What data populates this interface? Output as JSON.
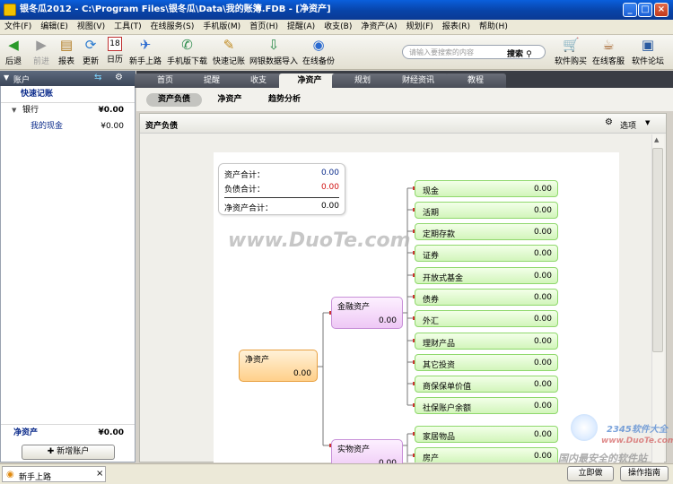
{
  "window": {
    "title": "银冬瓜2012 - C:\\Program Files\\银冬瓜\\Data\\我的账簿.FDB - [净资产]",
    "minimize": "_",
    "maximize": "□",
    "close": "×"
  },
  "menu": [
    "文件(F)",
    "编辑(E)",
    "视图(V)",
    "工具(T)",
    "在线服务(S)",
    "手机版(M)",
    "首页(H)",
    "提醒(A)",
    "收支(B)",
    "净资产(A)",
    "规划(F)",
    "报表(R)",
    "帮助(H)"
  ],
  "toolbar": [
    {
      "label": "后退",
      "icon": "◀"
    },
    {
      "label": "前进",
      "icon": "▶"
    },
    {
      "label": "报表",
      "icon": "▤"
    },
    {
      "label": "更新",
      "icon": "⟳"
    },
    {
      "label": "日历",
      "icon": "18"
    },
    {
      "label": "新手上路",
      "icon": "✈"
    },
    {
      "label": "手机版下载",
      "icon": "✆"
    },
    {
      "label": "快速记账",
      "icon": "✎"
    },
    {
      "label": "网银数据导入",
      "icon": "⇩"
    },
    {
      "label": "在线备份",
      "icon": "◉"
    },
    {
      "label": "软件购买",
      "icon": "🛒"
    },
    {
      "label": "在线客服",
      "icon": "☕"
    },
    {
      "label": "软件论坛",
      "icon": "▣"
    }
  ],
  "search": {
    "placeholder": "请输入要搜索的内容",
    "button": "搜索"
  },
  "left": {
    "header": "账户",
    "quick": "快速记账",
    "bank": {
      "name": "银行",
      "value": "¥0.00"
    },
    "cash": {
      "name": "我的现金",
      "value": "¥0.00"
    },
    "net": {
      "name": "净资产",
      "value": "¥0.00"
    },
    "add": "新增账户"
  },
  "tabs": [
    "首页",
    "提醒",
    "收支",
    "净资产",
    "规划",
    "财经资讯",
    "教程"
  ],
  "subtabs": [
    "资产负债",
    "净资产",
    "趋势分析"
  ],
  "panel": {
    "title": "资产负债",
    "options": "选项"
  },
  "summary": [
    {
      "label": "资产合计：",
      "value": "0.00",
      "color": "#0a2a8a"
    },
    {
      "label": "负债合计：",
      "value": "0.00",
      "color": "#d01010"
    },
    {
      "label": "净资产合计：",
      "value": "0.00",
      "color": "#000000"
    }
  ],
  "tree": {
    "root": {
      "label": "净资产",
      "value": "0.00"
    },
    "financial": {
      "label": "金融资产",
      "value": "0.00"
    },
    "physical": {
      "label": "实物资产",
      "value": "0.00"
    },
    "financial_items": [
      {
        "label": "现金",
        "value": "0.00"
      },
      {
        "label": "活期",
        "value": "0.00"
      },
      {
        "label": "定期存款",
        "value": "0.00"
      },
      {
        "label": "证券",
        "value": "0.00"
      },
      {
        "label": "开放式基金",
        "value": "0.00"
      },
      {
        "label": "债券",
        "value": "0.00"
      },
      {
        "label": "外汇",
        "value": "0.00"
      },
      {
        "label": "理财产品",
        "value": "0.00"
      },
      {
        "label": "其它投资",
        "value": "0.00"
      },
      {
        "label": "商保保单价值",
        "value": "0.00"
      },
      {
        "label": "社保账户余额",
        "value": "0.00"
      }
    ],
    "physical_items": [
      {
        "label": "家居物品",
        "value": "0.00"
      },
      {
        "label": "房产",
        "value": "0.00"
      }
    ]
  },
  "status": {
    "task": "新手上路",
    "close": "×",
    "now": "立即做",
    "guide": "操作指南"
  },
  "watermarks": {
    "main": "www.DuoTe.com",
    "corner1": "2345软件大全",
    "corner2": "www.DuoTe.com",
    "corner3": "国内最安全的软件站"
  }
}
